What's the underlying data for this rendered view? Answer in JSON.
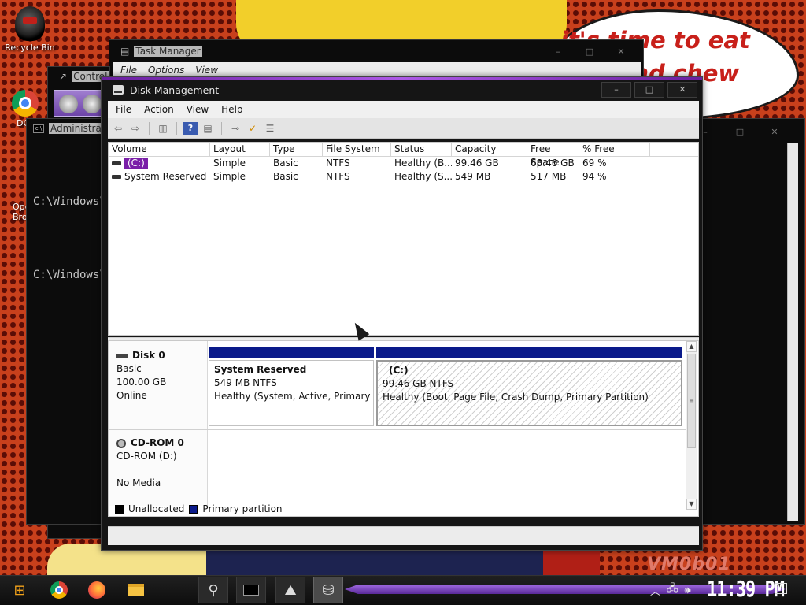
{
  "wallpaper": {
    "bubble_text": "it's time to eat shit and chew",
    "signature": "VM0b01"
  },
  "desktop": {
    "icons": [
      {
        "label": "Recycle Bin",
        "icon": "recycle-bin-icon"
      },
      {
        "label": "DC",
        "icon": "chrome-icon"
      },
      {
        "label": "Ope\nBro",
        "icon": "opera-icon"
      }
    ]
  },
  "task_manager": {
    "title": "Task Manager",
    "menu": [
      "File",
      "Options",
      "View"
    ]
  },
  "control_panel": {
    "title": "Control"
  },
  "cmd": {
    "title": "Administra",
    "lines": [
      "C:\\Windows\\",
      "C:\\Windows\\"
    ]
  },
  "disk_management": {
    "title": "Disk Management",
    "caption_buttons": {
      "minimize": "–",
      "maximize": "□",
      "close": "✕"
    },
    "menu": [
      "File",
      "Action",
      "View",
      "Help"
    ],
    "columns": [
      "Volume",
      "Layout",
      "Type",
      "File System",
      "Status",
      "Capacity",
      "Free Space",
      "% Free"
    ],
    "volumes": [
      {
        "volume": "(C:)",
        "layout": "Simple",
        "type": "Basic",
        "fs": "NTFS",
        "status": "Healthy (B...",
        "capacity": "99.46 GB",
        "free": "68.46 GB",
        "pct": "69 %",
        "selected": true
      },
      {
        "volume": "System Reserved",
        "layout": "Simple",
        "type": "Basic",
        "fs": "NTFS",
        "status": "Healthy (S...",
        "capacity": "549 MB",
        "free": "517 MB",
        "pct": "94 %",
        "selected": false
      }
    ],
    "disks": [
      {
        "name": "Disk 0",
        "type": "Basic",
        "size": "100.00 GB",
        "state": "Online",
        "partitions": [
          {
            "name": "System Reserved",
            "size": "549 MB NTFS",
            "status": "Healthy (System, Active, Primary Pa"
          },
          {
            "name": "(C:)",
            "size": "99.46 GB NTFS",
            "status": "Healthy (Boot, Page File, Crash Dump, Primary Partition)"
          }
        ]
      },
      {
        "name": "CD-ROM 0",
        "type": "CD-ROM (D:)",
        "state": "No Media"
      }
    ],
    "legend": [
      {
        "label": "Unallocated",
        "color": "#000000"
      },
      {
        "label": "Primary partition",
        "color": "#0a1a8a"
      }
    ]
  },
  "taskbar": {
    "clock": "11:39 PM",
    "items": [
      "start-icon",
      "chrome-icon",
      "firefox-icon",
      "file-explorer-icon",
      "disk-management-icon",
      "command-prompt-icon",
      "task-manager-icon",
      "disk-drive-icon"
    ]
  },
  "colors": {
    "accent": "#7a1fa8",
    "partition": "#0a1a8a"
  }
}
